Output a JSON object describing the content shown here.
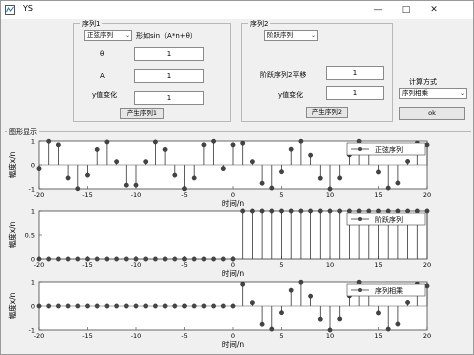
{
  "window": {
    "title": "YS",
    "icon": "matlab-figure-icon",
    "minimize_icon": "minimize-icon",
    "maximize_icon": "maximize-icon",
    "close_icon": "close-icon"
  },
  "seq1": {
    "group_label": "序列1",
    "type_value": "正弦序列",
    "formula": "形如sin（A*n+θ）",
    "theta_label": "θ",
    "theta_value": "1",
    "a_label": "A",
    "a_value": "1",
    "y_label": "y值变化",
    "y_value": "1",
    "button": "产生序列1"
  },
  "seq2": {
    "group_label": "序列2",
    "type_value": "阶跃序列",
    "shift_label": "阶跃序列2平移",
    "shift_value": "1",
    "y_label": "y值变化",
    "y_value": "1",
    "button": "产生序列2"
  },
  "compute": {
    "label": "计算方式",
    "value": "序列相乘",
    "ok": "ok"
  },
  "graph_group_label": "图形显示",
  "colors": {
    "stem": "#333333",
    "marker": "#444444",
    "axis_bg": "#ffffff",
    "window_bg": "#f0f0f0"
  },
  "chart_data": [
    {
      "type": "scatter",
      "legend": "正弦序列",
      "xlabel": "时间/n",
      "ylabel": "幅度x/n",
      "xlim": [
        -20,
        20
      ],
      "ylim": [
        -1,
        1
      ],
      "xticks": [
        "-20",
        "-15",
        "-10",
        "-5",
        "0",
        "5",
        "10",
        "15",
        "20"
      ],
      "yticks": [
        "1",
        "0",
        "-1"
      ],
      "x": [
        -20,
        -19,
        -18,
        -17,
        -16,
        -15,
        -14,
        -13,
        -12,
        -11,
        -10,
        -9,
        -8,
        -7,
        -6,
        -5,
        -4,
        -3,
        -2,
        -1,
        0,
        1,
        2,
        3,
        4,
        5,
        6,
        7,
        8,
        9,
        10,
        11,
        12,
        13,
        14,
        15,
        16,
        17,
        18,
        19,
        20
      ],
      "y": [
        -0.15,
        0.99,
        0.84,
        -0.54,
        -0.99,
        -0.42,
        0.65,
        0.96,
        0.14,
        -0.84,
        -0.84,
        0.14,
        0.96,
        0.65,
        -0.42,
        -0.99,
        -0.54,
        0.84,
        0.99,
        -0.15,
        0.84,
        0.91,
        0.14,
        -0.76,
        -0.96,
        -0.28,
        0.66,
        0.99,
        0.41,
        -0.55,
        -1.0,
        -0.54,
        0.42,
        0.99,
        0.65,
        -0.29,
        -0.96,
        -0.75,
        0.15,
        0.91,
        0.84
      ]
    },
    {
      "type": "scatter",
      "legend": "阶跃序列",
      "xlabel": "时间/n",
      "ylabel": "幅度x/n",
      "xlim": [
        -20,
        20
      ],
      "ylim": [
        0,
        1
      ],
      "xticks": [
        "-20",
        "-15",
        "-10",
        "-5",
        "0",
        "5",
        "10",
        "15",
        "20"
      ],
      "yticks": [
        "1",
        "0.5",
        "0"
      ],
      "x": [
        -20,
        -19,
        -18,
        -17,
        -16,
        -15,
        -14,
        -13,
        -12,
        -11,
        -10,
        -9,
        -8,
        -7,
        -6,
        -5,
        -4,
        -3,
        -2,
        -1,
        0,
        1,
        2,
        3,
        4,
        5,
        6,
        7,
        8,
        9,
        10,
        11,
        12,
        13,
        14,
        15,
        16,
        17,
        18,
        19,
        20
      ],
      "y": [
        0,
        0,
        0,
        0,
        0,
        0,
        0,
        0,
        0,
        0,
        0,
        0,
        0,
        0,
        0,
        0,
        0,
        0,
        0,
        0,
        0,
        1,
        1,
        1,
        1,
        1,
        1,
        1,
        1,
        1,
        1,
        1,
        1,
        1,
        1,
        1,
        1,
        1,
        1,
        1,
        1
      ]
    },
    {
      "type": "scatter",
      "legend": "序列相乘",
      "xlabel": "时间/n",
      "ylabel": "幅度x/n",
      "xlim": [
        -20,
        20
      ],
      "ylim": [
        -1,
        1
      ],
      "xticks": [
        "-20",
        "-15",
        "-10",
        "-5",
        "0",
        "5",
        "10",
        "15",
        "20"
      ],
      "yticks": [
        "1",
        "0",
        "-1"
      ],
      "x": [
        -20,
        -19,
        -18,
        -17,
        -16,
        -15,
        -14,
        -13,
        -12,
        -11,
        -10,
        -9,
        -8,
        -7,
        -6,
        -5,
        -4,
        -3,
        -2,
        -1,
        0,
        1,
        2,
        3,
        4,
        5,
        6,
        7,
        8,
        9,
        10,
        11,
        12,
        13,
        14,
        15,
        16,
        17,
        18,
        19,
        20
      ],
      "y": [
        0,
        0,
        0,
        0,
        0,
        0,
        0,
        0,
        0,
        0,
        0,
        0,
        0,
        0,
        0,
        0,
        0,
        0,
        0,
        0,
        0,
        0.91,
        0.14,
        -0.76,
        -0.96,
        -0.28,
        0.66,
        0.99,
        0.41,
        -0.55,
        -1.0,
        -0.54,
        0.42,
        0.99,
        0.65,
        -0.29,
        -0.96,
        -0.75,
        0.15,
        0.91,
        0.84
      ]
    }
  ]
}
